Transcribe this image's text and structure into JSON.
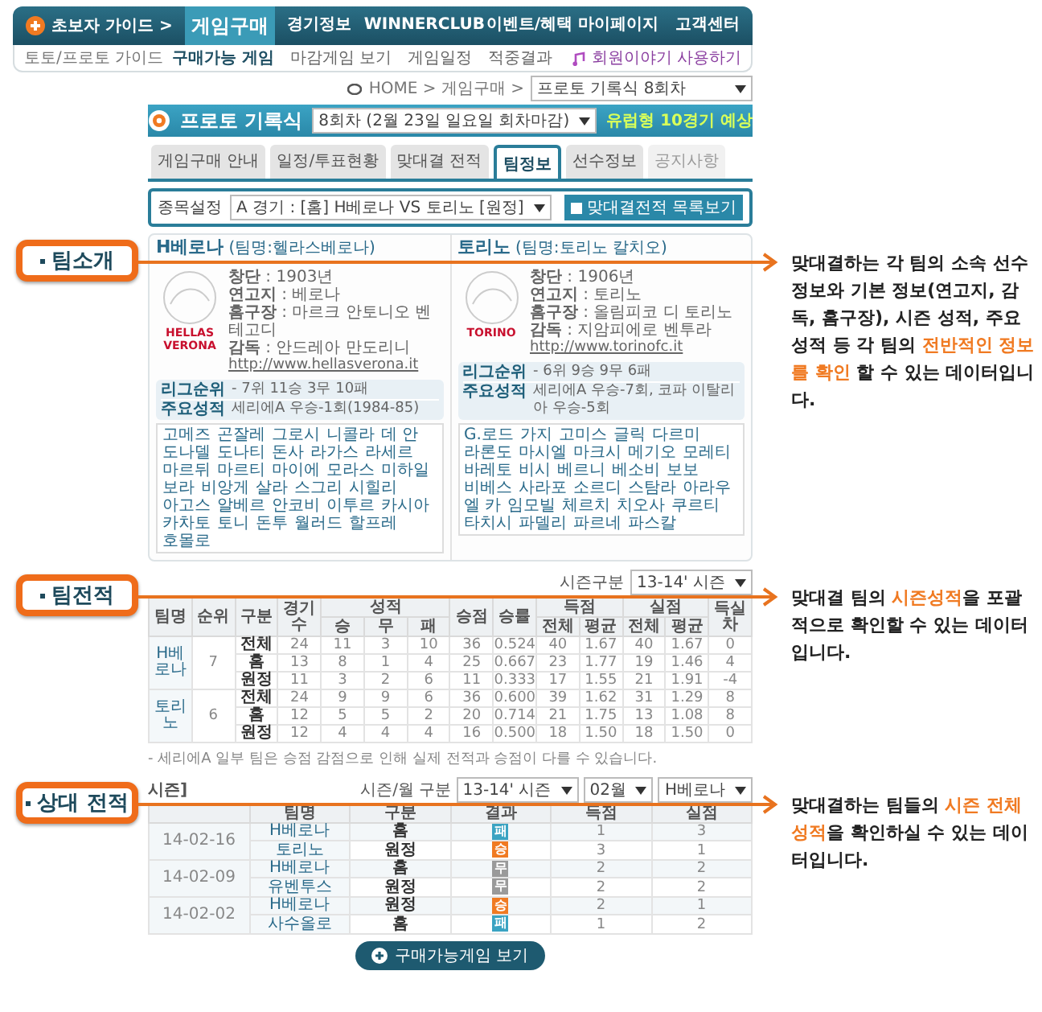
{
  "nav": {
    "guide": "초보자 가이드 >",
    "items": [
      {
        "label": "게임구매",
        "selected": true
      },
      {
        "label": "경기정보",
        "selected": false
      },
      {
        "label": "WINNERCLUB",
        "selected": false
      },
      {
        "label": "이벤트/혜택",
        "selected": false
      },
      {
        "label": "마이페이지",
        "selected": false
      },
      {
        "label": "고객센터",
        "selected": false
      }
    ]
  },
  "subnav": {
    "guide": "토토/프로토 가이드",
    "items": [
      {
        "label": "구매가능 게임",
        "selected": true
      },
      {
        "label": "마감게임 보기",
        "selected": false
      },
      {
        "label": "게임일정",
        "selected": false
      },
      {
        "label": "적중결과",
        "selected": false
      }
    ],
    "link": "회원이야기 사용하기"
  },
  "breadcrumb": {
    "text": "HOME > 게임구매 >",
    "select": "프로토 기록식 8회차"
  },
  "banner": {
    "title": "프로토 기록식",
    "select": "8회차 (2월 23일 일요일 회차마감)",
    "note": "유럽형 10경기 예상"
  },
  "tabs": [
    {
      "label": "게임구매 안내",
      "selected": false,
      "disabled": false
    },
    {
      "label": "일정/투표현황",
      "selected": false,
      "disabled": false
    },
    {
      "label": "맞대결 전적",
      "selected": false,
      "disabled": false
    },
    {
      "label": "팀정보",
      "selected": true,
      "disabled": false
    },
    {
      "label": "선수정보",
      "selected": false,
      "disabled": false
    },
    {
      "label": "공지사항",
      "selected": false,
      "disabled": true
    }
  ],
  "filter": {
    "label": "종목설정",
    "select": "A 경기 : [홈] H베로나 VS 토리노 [원정]",
    "button": "맞대결전적 목록보기"
  },
  "team_intro": {
    "callout": "팀소개",
    "annotation": [
      {
        "text": "맞대결하는 각 팀의 소속 선수 정보와 기본 정보(연고지, 감독, 홈구장), 시즌 성적, 주요성적 등 각 팀의 ",
        "highlight": false
      },
      {
        "text": "전반적인 정보를 확인",
        "highlight": true
      },
      {
        "text": " 할 수 있는 데이터입니다.",
        "highlight": false
      }
    ],
    "teams": [
      {
        "name": "H베로나",
        "full_name": "(팀명:헬라스베로나)",
        "logo": "HELLAS VERONA",
        "info": [
          "**창단** : 1903년",
          "**연고지** : 베로나",
          "**홈구장** : 마르크 안토니오 벤테고디",
          "**감독** : 안드레아 만도리니"
        ],
        "website": "http://www.hellasverona.it",
        "league": [
          {
            "label": "리그순위",
            "value": "- 7위 11승 3무 10패"
          },
          {
            "label": "주요성적",
            "value": "세리에A 우승-1회(1984-85)"
          }
        ],
        "players": [
          "고메즈",
          "곤잘레",
          "그로시",
          "니콜라",
          "데 안",
          "도나델",
          "도나티",
          "돈사",
          "라가스",
          "라세르",
          "마르뒤",
          "마르티",
          "마이에",
          "모라스",
          "미하일",
          "보라",
          "비앙게",
          "살라",
          "스그리",
          "시힐리",
          "아고스",
          "알베르",
          "안코비",
          "이투르",
          "카시아",
          "카차토",
          "토니",
          "돈투",
          "월러드",
          "할프레",
          "호몰로"
        ]
      },
      {
        "name": "토리노",
        "full_name": "(팀명:토리노 칼치오)",
        "logo": "TORINO",
        "info": [
          "**창단** : 1906년",
          "**연고지** : 토리노",
          "**홈구장** : 올림피코 디 토리노",
          "**감독** : 지암피에로 벤투라"
        ],
        "website": "http://www.torinofc.it",
        "league": [
          {
            "label": "리그순위",
            "value": "- 6위 9승 9무 6패"
          },
          {
            "label": "주요성적",
            "value": "세리에A 우승-7회, 코파 이탈리아 우승-5회"
          }
        ],
        "players": [
          "G.로드",
          "가지",
          "고미스",
          "글릭",
          "다르미",
          "라론도",
          "마시엘",
          "마크시",
          "메기오",
          "모레티",
          "바레토",
          "비시",
          "베르니",
          "베소비",
          "보보",
          "비베스",
          "사라포",
          "소르디",
          "스탐라",
          "아라우",
          "엘 카",
          "임모빌",
          "체르치",
          "치오사",
          "쿠르티",
          "타치시",
          "파델리",
          "파르네",
          "파스칼"
        ]
      }
    ]
  },
  "team_record": {
    "callout": "팀전적",
    "annotation": [
      {
        "text": "맞대결 팀의 ",
        "highlight": false
      },
      {
        "text": "시즌성적",
        "highlight": true
      },
      {
        "text": "을 포괄적으로 확인할 수 있는 데이터입니다.",
        "highlight": false
      }
    ],
    "season": {
      "label": "시즌구분",
      "value": "13-14' 시즌"
    },
    "columns": [
      {
        "label": "팀명"
      },
      {
        "label": "순위"
      },
      {
        "label": "구분"
      },
      {
        "label": "경기수"
      },
      {
        "label": "성적",
        "sub": [
          "승",
          "무",
          "패"
        ]
      },
      {
        "label": "승점"
      },
      {
        "label": "승률"
      },
      {
        "label": "득점",
        "sub": [
          "전체",
          "평균"
        ]
      },
      {
        "label": "실점",
        "sub": [
          "전체",
          "평균"
        ]
      },
      {
        "label": "득실차"
      }
    ],
    "teams": [
      {
        "name": "H베로나",
        "rank": "7",
        "rows": [
          {
            "type": "전체",
            "cells": [
              "24",
              "11",
              "3",
              "10",
              "36",
              "0.524",
              "40",
              "1.67",
              "40",
              "1.67",
              "0"
            ]
          },
          {
            "type": "홈",
            "cells": [
              "13",
              "8",
              "1",
              "4",
              "25",
              "0.667",
              "23",
              "1.77",
              "19",
              "1.46",
              "4"
            ]
          },
          {
            "type": "원정",
            "cells": [
              "11",
              "3",
              "2",
              "6",
              "11",
              "0.333",
              "17",
              "1.55",
              "21",
              "1.91",
              "-4"
            ]
          }
        ]
      },
      {
        "name": "토리노",
        "rank": "6",
        "rows": [
          {
            "type": "전체",
            "cells": [
              "24",
              "9",
              "9",
              "6",
              "36",
              "0.600",
              "39",
              "1.62",
              "31",
              "1.29",
              "8"
            ]
          },
          {
            "type": "홈",
            "cells": [
              "12",
              "5",
              "5",
              "2",
              "20",
              "0.714",
              "21",
              "1.75",
              "13",
              "1.08",
              "8"
            ]
          },
          {
            "type": "원정",
            "cells": [
              "12",
              "4",
              "4",
              "4",
              "16",
              "0.500",
              "18",
              "1.50",
              "18",
              "1.50",
              "0"
            ]
          }
        ]
      }
    ]
  },
  "note": "- 세리에A 일부 팀은 승점 감점으로 인해 실제 전적과 승점이 다를 수 있습니다.",
  "head_to_head": {
    "callout": "상대 전적",
    "annotation": [
      {
        "text": "맞대결하는 팀들의 ",
        "highlight": false
      },
      {
        "text": "시즌 전체성적",
        "highlight": true
      },
      {
        "text": "을 확인하실 수 있는 데이터입니다.",
        "highlight": false
      }
    ],
    "title_tail": "시즌]",
    "filter_label": "시즌/월 구분",
    "selects": [
      "13-14' 시즌",
      "02월",
      "H베로나"
    ],
    "columns": [
      "팀명",
      "구분",
      "결과",
      "득점",
      "실점"
    ],
    "groups": [
      {
        "date": "14-02-16",
        "rows": [
          {
            "team": "H베로나",
            "venue": "홈",
            "result": {
              "text": "패",
              "color": "#3aa3c2"
            },
            "gf": "1",
            "ga": "3"
          },
          {
            "team": "토리노",
            "venue": "원정",
            "result": {
              "text": "승",
              "color": "#f07a22"
            },
            "gf": "3",
            "ga": "1"
          }
        ]
      },
      {
        "date": "14-02-09",
        "rows": [
          {
            "team": "H베로나",
            "venue": "홈",
            "result": {
              "text": "무",
              "color": "#9a9a9a"
            },
            "gf": "2",
            "ga": "2"
          },
          {
            "team": "유벤투스",
            "venue": "원정",
            "result": {
              "text": "무",
              "color": "#9a9a9a"
            },
            "gf": "2",
            "ga": "2"
          }
        ]
      },
      {
        "date": "14-02-02",
        "rows": [
          {
            "team": "H베로나",
            "venue": "원정",
            "result": {
              "text": "승",
              "color": "#f07a22"
            },
            "gf": "2",
            "ga": "1"
          },
          {
            "team": "사수올로",
            "venue": "홈",
            "result": {
              "text": "패",
              "color": "#3aa3c2"
            },
            "gf": "1",
            "ga": "2"
          }
        ]
      }
    ]
  },
  "bottom_button": "구매가능게임 보기"
}
